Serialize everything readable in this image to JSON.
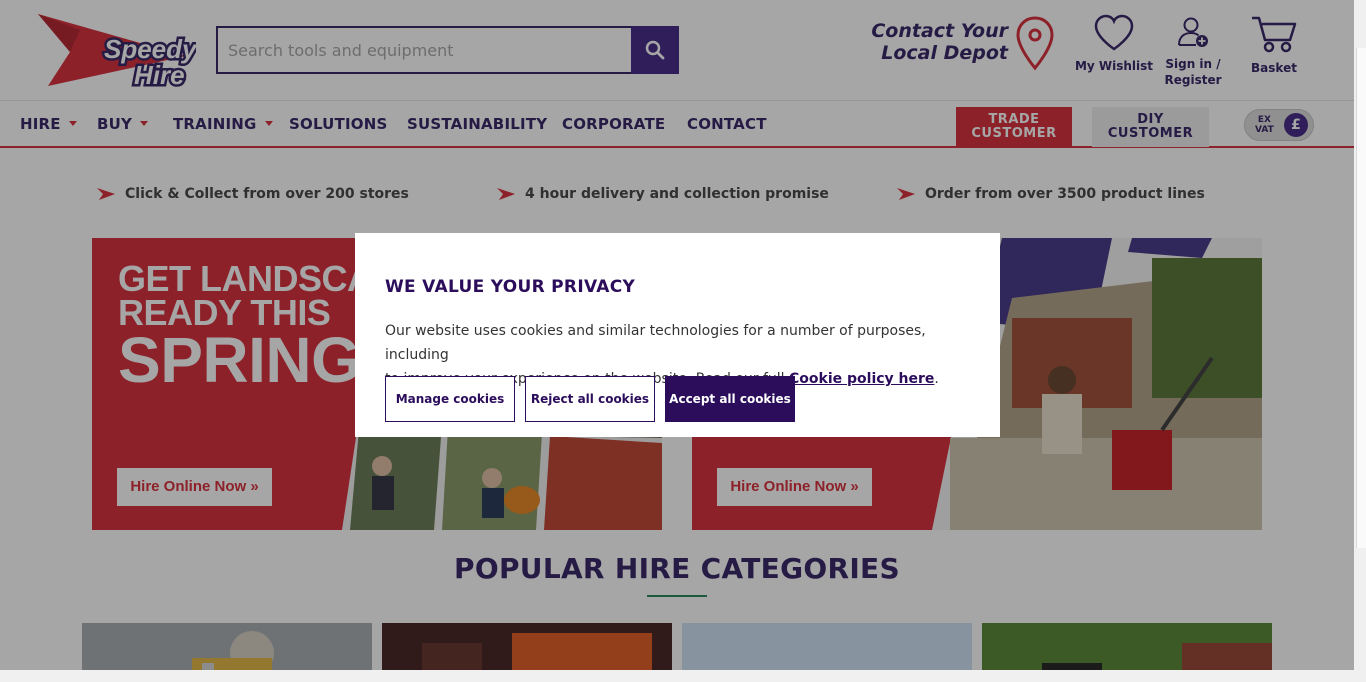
{
  "brand": {
    "logo_line1": "Speedy",
    "logo_line2": "Hire",
    "accent": "#d9333f",
    "primary": "#3b2a6b"
  },
  "search": {
    "placeholder": "Search tools and equipment"
  },
  "header": {
    "contact_line1": "Contact Your",
    "contact_line2": "Local Depot",
    "wishlist_label": "My Wishlist",
    "signin_line1": "Sign in /",
    "signin_line2": "Register",
    "basket_label": "Basket"
  },
  "nav": {
    "items": [
      {
        "label": "HIRE",
        "dropdown": true
      },
      {
        "label": "BUY",
        "dropdown": true
      },
      {
        "label": "TRAINING",
        "dropdown": true
      },
      {
        "label": "SOLUTIONS",
        "dropdown": false
      },
      {
        "label": "SUSTAINABILITY",
        "dropdown": false
      },
      {
        "label": "CORPORATE",
        "dropdown": false
      },
      {
        "label": "CONTACT",
        "dropdown": false
      }
    ],
    "trade_line1": "TRADE",
    "trade_line2": "CUSTOMER",
    "diy_line1": "DIY",
    "diy_line2": "CUSTOMER",
    "vat_line1": "EX",
    "vat_line2": "VAT",
    "currency_symbol": "£"
  },
  "usps": [
    "Click & Collect from over 200 stores",
    "4 hour delivery and collection promise",
    "Order from over 3500 product lines"
  ],
  "banners": [
    {
      "title_line1": "GET LANDSCAPE",
      "title_line2": "READY THIS",
      "title_line3": "SPRING",
      "cta": "Hire Online Now »"
    },
    {
      "cta": "Hire Online Now »"
    }
  ],
  "popular": {
    "title": "POPULAR HIRE CATEGORIES"
  },
  "cookie_modal": {
    "title": "WE VALUE YOUR PRIVACY",
    "body_line1": "Our website uses cookies and similar technologies for a number of purposes, including",
    "body_line2": "to improve your experience on the website. Read our full ",
    "policy_link": "Cookie policy here",
    "body_end": ".",
    "manage_label": "Manage cookies",
    "reject_label": "Reject all cookies",
    "accept_label": "Accept all cookies"
  }
}
